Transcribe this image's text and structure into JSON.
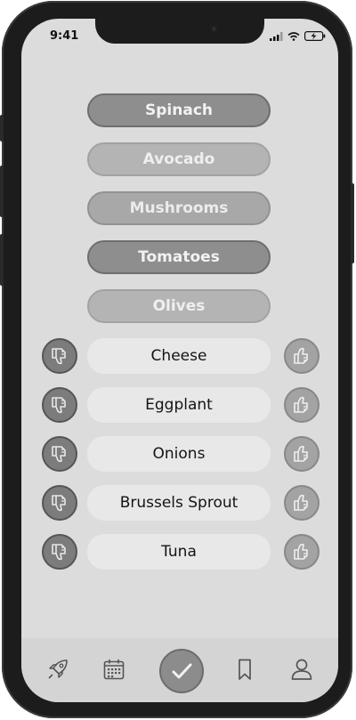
{
  "status_bar": {
    "time": "9:41"
  },
  "selected_items": [
    {
      "label": "Spinach",
      "style": "dark"
    },
    {
      "label": "Avocado",
      "style": "light"
    },
    {
      "label": "Mushrooms",
      "style": "mid"
    },
    {
      "label": "Tomatoes",
      "style": "dark"
    },
    {
      "label": "Olives",
      "style": "light"
    }
  ],
  "rating_items": [
    {
      "label": "Cheese"
    },
    {
      "label": "Eggplant"
    },
    {
      "label": "Onions"
    },
    {
      "label": "Brussels Sprout"
    },
    {
      "label": "Tuna"
    }
  ],
  "tab_bar": {
    "tabs": [
      "rocket-icon",
      "calendar-icon",
      "check-icon",
      "bookmark-icon",
      "profile-icon"
    ]
  },
  "colors": {
    "screen_bg": "#dcdcdc",
    "dislike": "#7c7c7c",
    "like": "#a3a3a3"
  }
}
